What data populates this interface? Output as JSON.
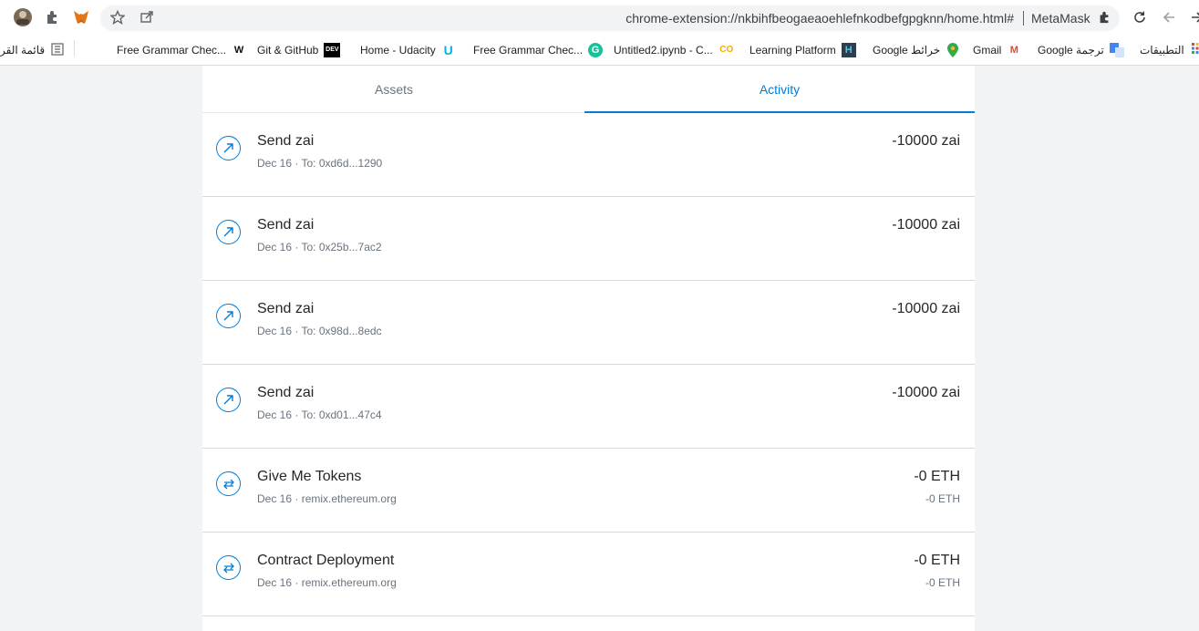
{
  "browser": {
    "url": "chrome-extension://nkbihfbeogaeaoehlefnkodbefgpgknn/home.html#",
    "extension_title": "MetaMask"
  },
  "bookmarks": {
    "reading_list": "قائمة القر",
    "items": [
      {
        "label": "Free Grammar Chec...",
        "icon": "W"
      },
      {
        "label": "Git & GitHub",
        "icon": "DEV"
      },
      {
        "label": "Home - Udacity",
        "icon": "U"
      },
      {
        "label": "Free Grammar Chec...",
        "icon": "G"
      },
      {
        "label": "Untitled2.ipynb - C...",
        "icon": "CO"
      },
      {
        "label": "Learning Platform",
        "icon": "H"
      },
      {
        "label": "Google خرائط",
        "icon": "map-pin-icon"
      },
      {
        "label": "Gmail",
        "icon": "M"
      },
      {
        "label": "Google ترجمة",
        "icon": "translate-icon"
      },
      {
        "label": "التطبيقات",
        "icon": "apps-grid-icon"
      }
    ]
  },
  "tabs": {
    "assets": "Assets",
    "activity": "Activity",
    "active": "activity"
  },
  "activity": [
    {
      "type": "send",
      "icon": "send-arrow-icon",
      "title": "Send zai",
      "date": "Dec 16",
      "detail": "To: 0xd6d...1290",
      "amount": "-10000 zai",
      "secondary": ""
    },
    {
      "type": "send",
      "icon": "send-arrow-icon",
      "title": "Send zai",
      "date": "Dec 16",
      "detail": "To: 0x25b...7ac2",
      "amount": "-10000 zai",
      "secondary": ""
    },
    {
      "type": "send",
      "icon": "send-arrow-icon",
      "title": "Send zai",
      "date": "Dec 16",
      "detail": "To: 0x98d...8edc",
      "amount": "-10000 zai",
      "secondary": ""
    },
    {
      "type": "send",
      "icon": "send-arrow-icon",
      "title": "Send zai",
      "date": "Dec 16",
      "detail": "To: 0xd01...47c4",
      "amount": "-10000 zai",
      "secondary": ""
    },
    {
      "type": "interaction",
      "icon": "swap-arrows-icon",
      "title": "Give Me Tokens",
      "date": "Dec 16",
      "detail": "remix.ethereum.org",
      "amount": "-0 ETH",
      "secondary": "-0 ETH"
    },
    {
      "type": "interaction",
      "icon": "swap-arrows-icon",
      "title": "Contract Deployment",
      "date": "Dec 16",
      "detail": "remix.ethereum.org",
      "amount": "-0 ETH",
      "secondary": "-0 ETH"
    }
  ],
  "colors": {
    "accent": "#037dd6",
    "background": "#f2f3f4",
    "text": "#24272a",
    "muted": "#6a737d"
  }
}
